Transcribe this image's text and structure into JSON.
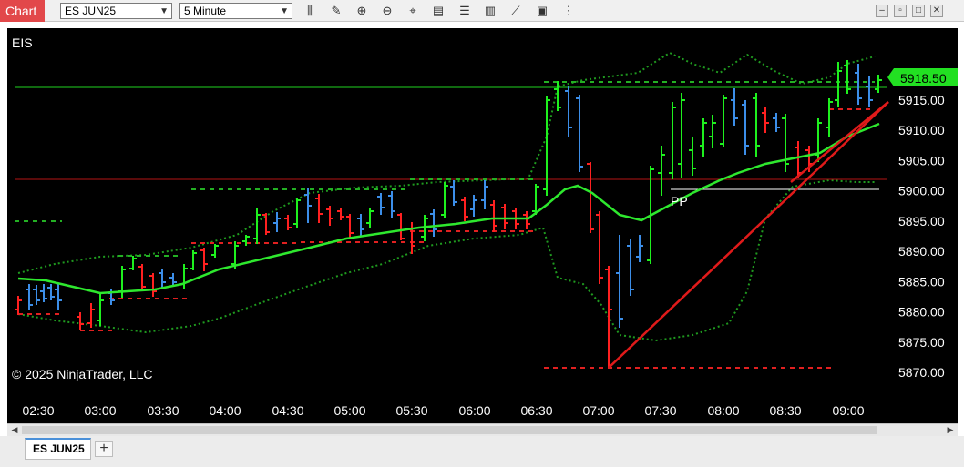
{
  "window": {
    "badge": "Chart",
    "instrument": "ES JUN25",
    "interval": "5 Minute",
    "tools": [
      "bar-style-icon",
      "draw-pencil-icon",
      "zoom-in-icon",
      "zoom-out-icon",
      "crosshair-icon",
      "data-box-icon",
      "properties-icon",
      "indicators-icon",
      "strategies-icon",
      "templates-icon",
      "more-icon"
    ],
    "controls": [
      "minimize-icon",
      "restore-icon",
      "maximize-icon",
      "close-icon"
    ]
  },
  "chart": {
    "symbol_label": "EIS",
    "copyright": "© 2025 NinjaTrader, LLC",
    "pivot_label": "PP",
    "last_price": "5918.50",
    "price_ticks": [
      "5915.00",
      "5910.00",
      "5905.00",
      "5900.00",
      "5895.00",
      "5890.00",
      "5885.00",
      "5880.00",
      "5875.00",
      "5870.00"
    ],
    "time_ticks": [
      "02:30",
      "03:00",
      "03:30",
      "04:00",
      "04:30",
      "05:00",
      "05:30",
      "06:00",
      "06:30",
      "07:00",
      "07:30",
      "08:00",
      "08:30",
      "09:00"
    ],
    "colors": {
      "up": "#1ef01e",
      "down": "#ff2020",
      "neutral": "#3c8ee8",
      "ma": "#2ee82e",
      "band": "#1f9a1f",
      "trend": "#e01a1a",
      "hline_green": "#1fd21f",
      "hline_red": "#b31515",
      "price_tag": "#22e022"
    }
  },
  "tabs": {
    "active": "ES JUN25",
    "add": "+"
  }
}
